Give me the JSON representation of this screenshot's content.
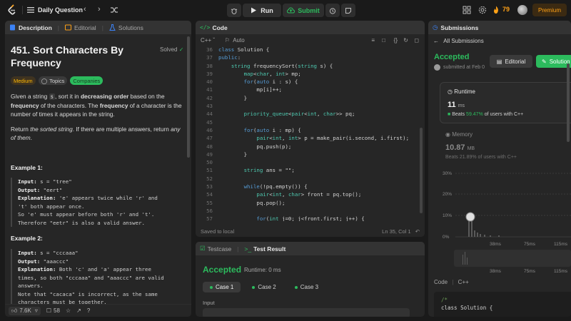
{
  "nav": {
    "title": "Daily Question",
    "run_label": "Run",
    "submit_label": "Submit",
    "streak": "79",
    "premium_label": "Premium"
  },
  "description": {
    "tabs": [
      "Description",
      "Editorial",
      "Solutions"
    ],
    "title": "451. Sort Characters By Frequency",
    "solved": "Solved",
    "tags": [
      "Medium",
      "Topics",
      "Companies"
    ],
    "para1_a": "Given a string ",
    "para1_code": "s",
    "para1_b": ", sort it in ",
    "para1_bold1": "decreasing order",
    "para1_c": " based on the ",
    "para1_bold2": "frequency",
    "para1_d": " of the characters. The ",
    "para1_bold3": "frequency",
    "para1_e": " of a character is the number of times it appears in the string.",
    "para2_a": "Return ",
    "para2_i1": "the sorted string",
    "para2_b": ". If there are multiple answers, return ",
    "para2_i2": "any of them",
    "para2_c": ".",
    "ex1_heading": "Example 1:",
    "ex1_input_label": "Input:",
    "ex1_input": " s = \"tree\"",
    "ex1_output_label": "Output:",
    "ex1_output": " \"eert\"",
    "ex1_expl_label": "Explanation:",
    "ex1_expl": " 'e' appears twice while 'r' and\n't' both appear once.\nSo 'e' must appear before both 'r' and 't'.\nTherefore \"eetr\" is also a valid answer.",
    "ex2_heading": "Example 2:",
    "ex2_input_label": "Input:",
    "ex2_input": " s = \"cccaaa\"",
    "ex2_output_label": "Output:",
    "ex2_output": " \"aaaccc\"",
    "ex2_expl_label": "Explanation:",
    "ex2_expl": " Both 'c' and 'a' appear three\ntimes, so both \"cccaaa\" and \"aaaccc\" are valid\nanswers.\nNote that \"cacaca\" is incorrect, as the same\ncharacters must be together.",
    "likes": "7.6K",
    "comments": "58"
  },
  "code": {
    "tab": "Code",
    "language": "C++",
    "mode": "Auto",
    "lines": [
      {
        "n": "36",
        "t": "class Solution {"
      },
      {
        "n": "37",
        "t": "public:"
      },
      {
        "n": "38",
        "t": "    string frequencySort(string s) {"
      },
      {
        "n": "39",
        "t": "        map<char, int> mp;"
      },
      {
        "n": "40",
        "t": "        for(auto i : s) {"
      },
      {
        "n": "41",
        "t": "            mp[i]++;"
      },
      {
        "n": "42",
        "t": "        }"
      },
      {
        "n": "43",
        "t": ""
      },
      {
        "n": "44",
        "t": "        priority_queue<pair<int, char>> pq;"
      },
      {
        "n": "45",
        "t": ""
      },
      {
        "n": "46",
        "t": "        for(auto i : mp) {"
      },
      {
        "n": "47",
        "t": "            pair<int, int> p = make_pair(i.second, i.first);"
      },
      {
        "n": "48",
        "t": "            pq.push(p);"
      },
      {
        "n": "49",
        "t": "        }"
      },
      {
        "n": "50",
        "t": ""
      },
      {
        "n": "51",
        "t": "        string ans = \"\";"
      },
      {
        "n": "52",
        "t": ""
      },
      {
        "n": "53",
        "t": "        while(!pq.empty()) {"
      },
      {
        "n": "54",
        "t": "            pair<int, char> front = pq.top();"
      },
      {
        "n": "55",
        "t": "            pq.pop();"
      },
      {
        "n": "56",
        "t": ""
      },
      {
        "n": "57",
        "t": "            for(int j=0; j<front.first; j++) {"
      },
      {
        "n": "58",
        "t": "                ans.push_back(front.second);"
      },
      {
        "n": "59",
        "t": "            }"
      }
    ],
    "saved": "Saved to local",
    "cursor": "Ln 35, Col 1"
  },
  "test": {
    "tab1": "Testcase",
    "tab2": "Test Result",
    "status": "Accepted",
    "runtime": "Runtime: 0 ms",
    "cases": [
      "Case 1",
      "Case 2",
      "Case 3"
    ],
    "input_label": "Input"
  },
  "submissions": {
    "tab": "Submissions",
    "back": "All Submissions",
    "status": "Accepted",
    "submitted": "submitted at Feb 0",
    "editorial": "Editorial",
    "solution": "Solution",
    "runtime_label": "Runtime",
    "runtime_val": "11",
    "runtime_unit": "ms",
    "beats_prefix": "Beats",
    "beats_pct": "59.47%",
    "beats_suffix": "of users with C++",
    "memory_label": "Memory",
    "memory_val": "10.87",
    "memory_unit": "MB",
    "memory_beats": "Beats 21.89% of users with C++",
    "chart_y": [
      "30%",
      "20%",
      "10%",
      "0%"
    ],
    "chart_x": [
      "38ms",
      "75ms",
      "115ms"
    ],
    "code_label": "Code",
    "code_lang": "C++",
    "snippet_line1": "/*",
    "snippet_line2": "class Solution {"
  }
}
